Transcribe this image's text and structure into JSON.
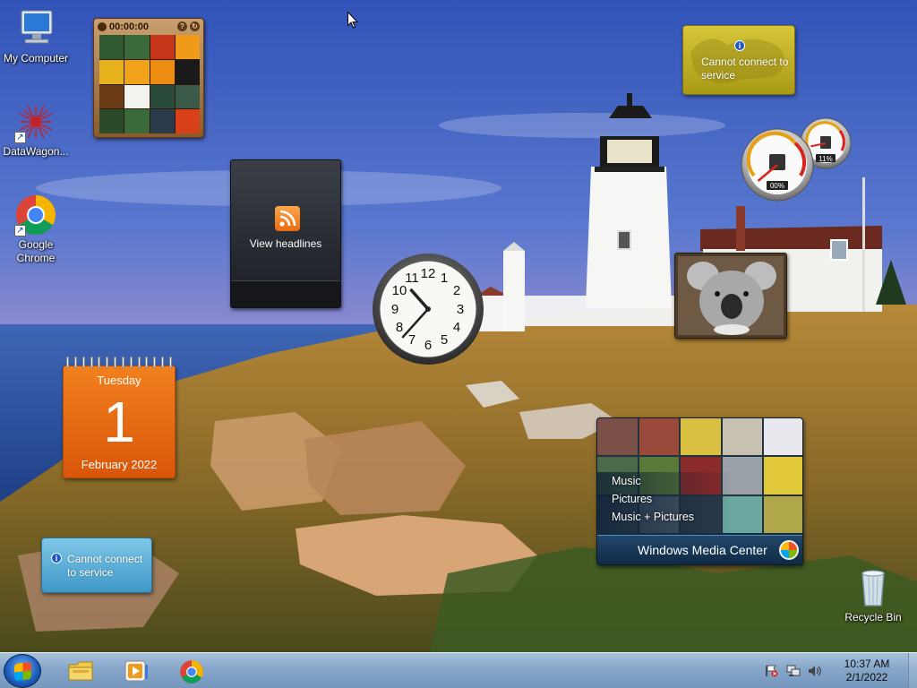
{
  "desktop_icons": [
    {
      "label": "My Computer",
      "icon": "computer-icon"
    },
    {
      "label": "DataWagon...",
      "icon": "datawagon-icon",
      "shortcut": true
    },
    {
      "label": "Google Chrome",
      "icon": "chrome-icon",
      "shortcut": true
    },
    {
      "label": "Recycle Bin",
      "icon": "recycle-bin-icon"
    }
  ],
  "gadgets": {
    "puzzle": {
      "timer": "00:00:00",
      "help_icon": "?"
    },
    "rss": {
      "label": "View headlines",
      "icon": "rss-icon"
    },
    "clock": {
      "time": "10:37"
    },
    "calendar": {
      "weekday": "Tuesday",
      "day": "1",
      "month_year": "February 2022"
    },
    "weather": {
      "message": "Cannot connect to service"
    },
    "currency": {
      "message": "Cannot connect to service"
    },
    "cpu_meter": {
      "cpu": "00%",
      "memory": "11%",
      "cpu_fraction": 0.0,
      "memory_fraction": 0.11
    },
    "slideshow": {
      "subject": "koala-photo"
    },
    "media_center": {
      "menu": [
        "Music",
        "Pictures",
        "Music + Pictures"
      ],
      "title_bold": "Windows",
      "title_rest": " Media Center"
    }
  },
  "taskbar": {
    "start": "start-button",
    "pinned": [
      "file-explorer-icon",
      "media-player-icon",
      "chrome-icon"
    ],
    "tray": [
      "action-center-flag-icon",
      "network-icon",
      "volume-icon"
    ],
    "time": "10:37 AM",
    "date": "2/1/2022"
  },
  "colors": {
    "calendar_orange": "#e86a10",
    "weather_yellow": "#c9b82a",
    "currency_blue": "#5aafd8",
    "taskbar": "#8fb0d2"
  }
}
